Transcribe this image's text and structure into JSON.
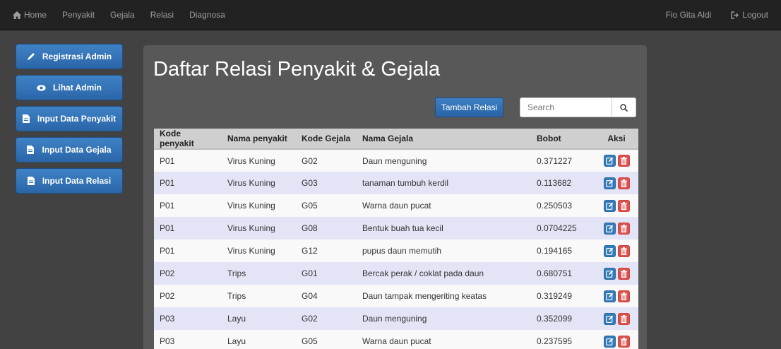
{
  "navbar": {
    "items": [
      {
        "label": "Home",
        "icon": "home-icon"
      },
      {
        "label": "Penyakit"
      },
      {
        "label": "Gejala"
      },
      {
        "label": "Relasi"
      },
      {
        "label": "Diagnosa"
      }
    ],
    "user_name": "Fio Gita Aldi",
    "logout_label": "Logout"
  },
  "sidebar": {
    "items": [
      {
        "label": "Registrasi Admin",
        "icon": "pencil-icon"
      },
      {
        "label": "Lihat Admin",
        "icon": "eye-icon"
      },
      {
        "label": "Input Data Penyakit",
        "icon": "file-icon"
      },
      {
        "label": "Input Data Gejala",
        "icon": "file-icon"
      },
      {
        "label": "Input Data Relasi",
        "icon": "file-icon"
      }
    ]
  },
  "main": {
    "title": "Daftar Relasi Penyakit & Gejala",
    "add_button_label": "Tambah Relasi",
    "search_placeholder": "Search",
    "table": {
      "headers": [
        "Kode penyakit",
        "Nama penyakit",
        "Kode Gejala",
        "Nama Gejala",
        "Bobot",
        "Aksi"
      ],
      "rows": [
        [
          "P01",
          "Virus Kuning",
          "G02",
          "Daun menguning",
          "0.371227"
        ],
        [
          "P01",
          "Virus Kuning",
          "G03",
          "tanaman tumbuh kerdil",
          "0.113682"
        ],
        [
          "P01",
          "Virus Kuning",
          "G05",
          "Warna daun pucat",
          "0.250503"
        ],
        [
          "P01",
          "Virus Kuning",
          "G08",
          "Bentuk buah tua kecil",
          "0.0704225"
        ],
        [
          "P01",
          "Virus Kuning",
          "G12",
          "pupus daun memutih",
          "0.194165"
        ],
        [
          "P02",
          "Trips",
          "G01",
          "Bercak perak / coklat pada daun",
          "0.680751"
        ],
        [
          "P02",
          "Trips",
          "G04",
          "Daun tampak mengeriting keatas",
          "0.319249"
        ],
        [
          "P03",
          "Layu",
          "G02",
          "Daun menguning",
          "0.352099"
        ],
        [
          "P03",
          "Layu",
          "G05",
          "Warna daun pucat",
          "0.237595"
        ]
      ]
    }
  }
}
